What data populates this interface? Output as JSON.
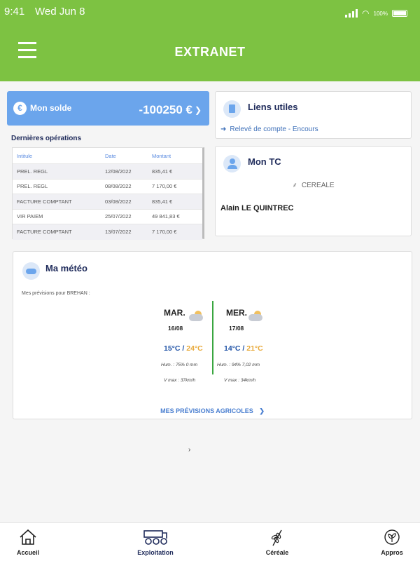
{
  "status_bar": {
    "time": "9:41",
    "date": "Wed Jun 8",
    "battery": "100%"
  },
  "header": {
    "title": "EXTRANET"
  },
  "solde": {
    "label": "Mon solde",
    "amount": "-100250 €",
    "currency_symbol": "€"
  },
  "operations": {
    "title": "Dernières opérations",
    "columns": [
      "Intitule",
      "Date",
      "Montant"
    ],
    "rows": [
      [
        "PREL. REGL",
        "12/08/2022",
        "835,41 €"
      ],
      [
        "PREL. REGL",
        "08/08/2022",
        "7 170,00 €"
      ],
      [
        "FACTURE COMPTANT",
        "03/08/2022",
        "835,41 €"
      ],
      [
        "VIR PAIEM",
        "25/07/2022",
        "49 841,83 €"
      ],
      [
        "FACTURE COMPTANT",
        "13/07/2022",
        "7 170,00 €"
      ]
    ]
  },
  "liens": {
    "title": "Liens utiles",
    "link": "Relevé de compte - Encours"
  },
  "tc": {
    "title": "Mon TC",
    "category": "CEREALE",
    "name": "Alain LE QUINTREC"
  },
  "meteo": {
    "title": "Ma météo",
    "subtitle": "Mes prévisions pour BREHAN :",
    "days": [
      {
        "name": "MAR.",
        "date": "16/08",
        "tmin": "15°C",
        "tmax": "24°C",
        "humidity": "Hum. : 75% 0 mm",
        "wind": "V max : 37km/h"
      },
      {
        "name": "MER.",
        "date": "17/08",
        "tmin": "14°C",
        "tmax": "21°C",
        "humidity": "Hum. : 94% 7,02 mm",
        "wind": "V max : 34km/h"
      }
    ],
    "more_link": "MES PRÉVISIONS AGRICOLES"
  },
  "pager": {
    "chevron": "›"
  },
  "tabs": [
    {
      "label": "Accueil",
      "icon": "home-icon"
    },
    {
      "label": "Exploitation",
      "icon": "tractor-icon",
      "active": true
    },
    {
      "label": "Céréale",
      "icon": "wheat-icon"
    },
    {
      "label": "Appros",
      "icon": "leaf-icon"
    }
  ],
  "colors": {
    "brand_green": "#7dc242",
    "accent_blue": "#6ba5ec",
    "navy": "#1e2a5a",
    "temp_max": "#e8a93a",
    "temp_min": "#2456a8"
  }
}
